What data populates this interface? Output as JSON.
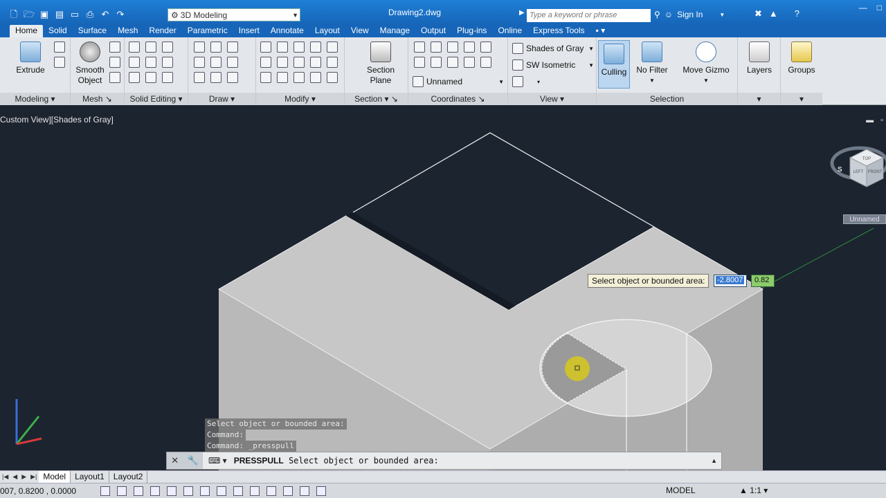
{
  "app": {
    "workspace": "3D Modeling",
    "document_title": "Drawing2.dwg",
    "search_placeholder": "Type a keyword or phrase",
    "sign_in": "Sign In"
  },
  "tabs": [
    "Home",
    "Solid",
    "Surface",
    "Mesh",
    "Render",
    "Parametric",
    "Insert",
    "Annotate",
    "Layout",
    "View",
    "Manage",
    "Output",
    "Plug-ins",
    "Online",
    "Express Tools"
  ],
  "ribbon": {
    "buttons": {
      "extrude": "Extrude",
      "smooth_object_line1": "Smooth",
      "smooth_object_line2": "Object",
      "section_plane_line1": "Section",
      "section_plane_line2": "Plane",
      "culling": "Culling",
      "no_filter": "No Filter",
      "move_gizmo": "Move Gizmo",
      "layers": "Layers",
      "groups": "Groups"
    },
    "combos": {
      "visual_style": "Shades of Gray",
      "view": "SW Isometric",
      "ucs": "Unnamed"
    },
    "panels": [
      "Modeling",
      "Mesh",
      "Solid Editing",
      "Draw",
      "Modify",
      "Section",
      "Coordinates",
      "View",
      "Selection"
    ]
  },
  "viewport": {
    "label": "Custom View][Shades of Gray]",
    "viewcube_label": "Unnamed",
    "viewcube_faces": [
      "TOP",
      "LEFT",
      "FRONT"
    ],
    "compass": "S"
  },
  "prompt": {
    "tooltip": "Select object or bounded area:",
    "value1": "-2.8007",
    "value2": "0.82"
  },
  "history": [
    "Select object or bounded area:",
    "Command:",
    "Command: _presspull"
  ],
  "command_line": {
    "command": "PRESSPULL",
    "prompt": "Select object or bounded area:"
  },
  "layout_tabs": [
    "Model",
    "Layout1",
    "Layout2"
  ],
  "status": {
    "coords": "007, 0.8200 , 0.0000",
    "model": "MODEL",
    "scale": "1:1"
  }
}
